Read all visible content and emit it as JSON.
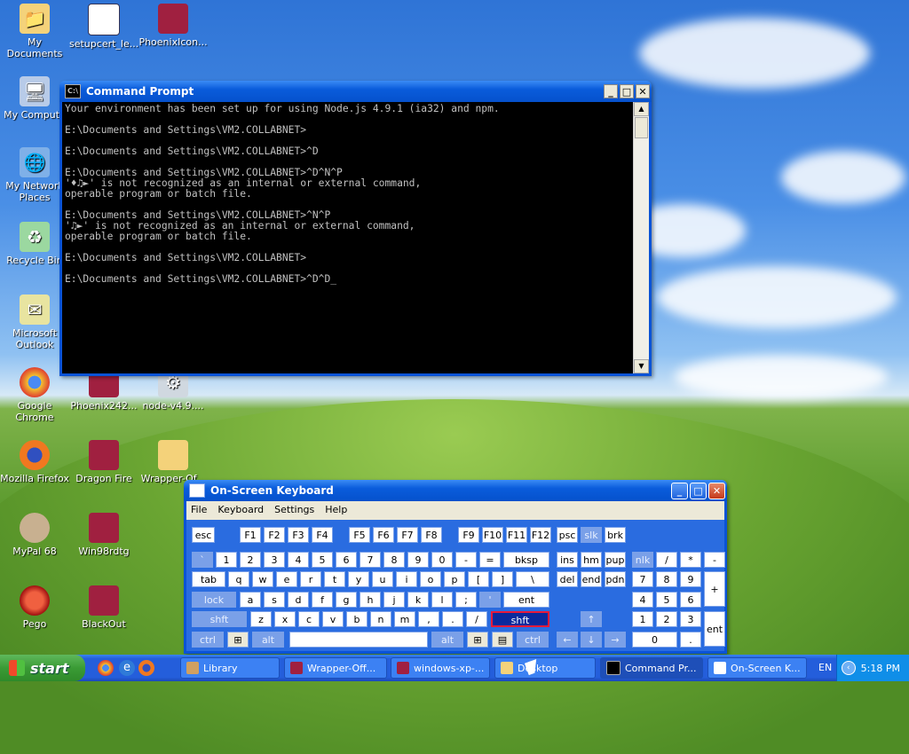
{
  "desktop": {
    "icons": [
      {
        "label": "My Documents",
        "icon": "folder-documents-icon"
      },
      {
        "label": "setupcert_le...",
        "icon": "window-icon"
      },
      {
        "label": "PhoenixIcon...",
        "icon": "winrar-icon"
      },
      {
        "label": "My Compute",
        "icon": "computer-icon"
      },
      {
        "label": "My Network Places",
        "icon": "network-icon"
      },
      {
        "label": "Recycle Bin",
        "icon": "recycle-bin-icon"
      },
      {
        "label": "Microsoft Outlook",
        "icon": "outlook-icon"
      },
      {
        "label": "Google Chrome",
        "icon": "chrome-icon"
      },
      {
        "label": "Phoenix242...",
        "icon": "winrar-icon"
      },
      {
        "label": "node-v4.9....",
        "icon": "installer-icon"
      },
      {
        "label": "Mozilla Firefox",
        "icon": "firefox-icon"
      },
      {
        "label": "Dragon Fire",
        "icon": "winrar-icon"
      },
      {
        "label": "Wrapper-Of...",
        "icon": "folder-icon"
      },
      {
        "label": "MyPal 68",
        "icon": "mypal-icon"
      },
      {
        "label": "Win98rdtg",
        "icon": "winrar-icon"
      },
      {
        "label": "Pego",
        "icon": "pego-icon"
      },
      {
        "label": "BlackOut",
        "icon": "winrar-icon"
      }
    ]
  },
  "cmd": {
    "title": "Command Prompt",
    "icon_text": "C:\\",
    "lines": [
      "Your environment has been set up for using Node.js 4.9.1 (ia32) and npm.",
      "",
      "E:\\Documents and Settings\\VM2.COLLABNET>",
      "",
      "E:\\Documents and Settings\\VM2.COLLABNET>^D",
      "",
      "E:\\Documents and Settings\\VM2.COLLABNET>^D^N^P",
      "'♦♫►' is not recognized as an internal or external command,",
      "operable program or batch file.",
      "",
      "E:\\Documents and Settings\\VM2.COLLABNET>^N^P",
      "'♫►' is not recognized as an internal or external command,",
      "operable program or batch file.",
      "",
      "E:\\Documents and Settings\\VM2.COLLABNET>",
      "",
      "E:\\Documents and Settings\\VM2.COLLABNET>^D^D_"
    ]
  },
  "osk": {
    "title": "On-Screen Keyboard",
    "menu": [
      "File",
      "Keyboard",
      "Settings",
      "Help"
    ],
    "rows": {
      "fn": [
        "esc",
        "F1",
        "F2",
        "F3",
        "F4",
        "F5",
        "F6",
        "F7",
        "F8",
        "F9",
        "F10",
        "F11",
        "F12",
        "psc",
        "slk",
        "brk"
      ],
      "num": [
        "`",
        "1",
        "2",
        "3",
        "4",
        "5",
        "6",
        "7",
        "8",
        "9",
        "0",
        "-",
        "=",
        "bksp",
        "ins",
        "hm",
        "pup",
        "nlk",
        "/",
        "*",
        "-"
      ],
      "top": [
        "tab",
        "q",
        "w",
        "e",
        "r",
        "t",
        "y",
        "u",
        "i",
        "o",
        "p",
        "[",
        "]",
        "\\",
        "del",
        "end",
        "pdn",
        "7",
        "8",
        "9",
        "+"
      ],
      "home": [
        "lock",
        "a",
        "s",
        "d",
        "f",
        "g",
        "h",
        "j",
        "k",
        "l",
        ";",
        "'",
        "ent",
        "4",
        "5",
        "6"
      ],
      "shift": [
        "shft",
        "z",
        "x",
        "c",
        "v",
        "b",
        "n",
        "m",
        ",",
        ".",
        "/",
        "shft",
        "↑",
        "1",
        "2",
        "3",
        "ent"
      ],
      "bottom": [
        "ctrl",
        "⊞",
        "alt",
        "",
        "alt",
        "⊞",
        "▤",
        "ctrl",
        "←",
        "↓",
        "→",
        "0",
        "."
      ]
    }
  },
  "taskbar": {
    "start_label": "start",
    "buttons": [
      {
        "label": "Library",
        "icon": "library-icon"
      },
      {
        "label": "Wrapper-Off...",
        "icon": "winrar-icon"
      },
      {
        "label": "windows-xp-...",
        "icon": "winrar-icon"
      },
      {
        "label": "Desktop",
        "icon": "folder-icon"
      },
      {
        "label": "Command Pr...",
        "icon": "cmd-icon"
      },
      {
        "label": "On-Screen K...",
        "icon": "keyboard-icon"
      }
    ],
    "language": "EN",
    "clock": "5:18 PM"
  }
}
